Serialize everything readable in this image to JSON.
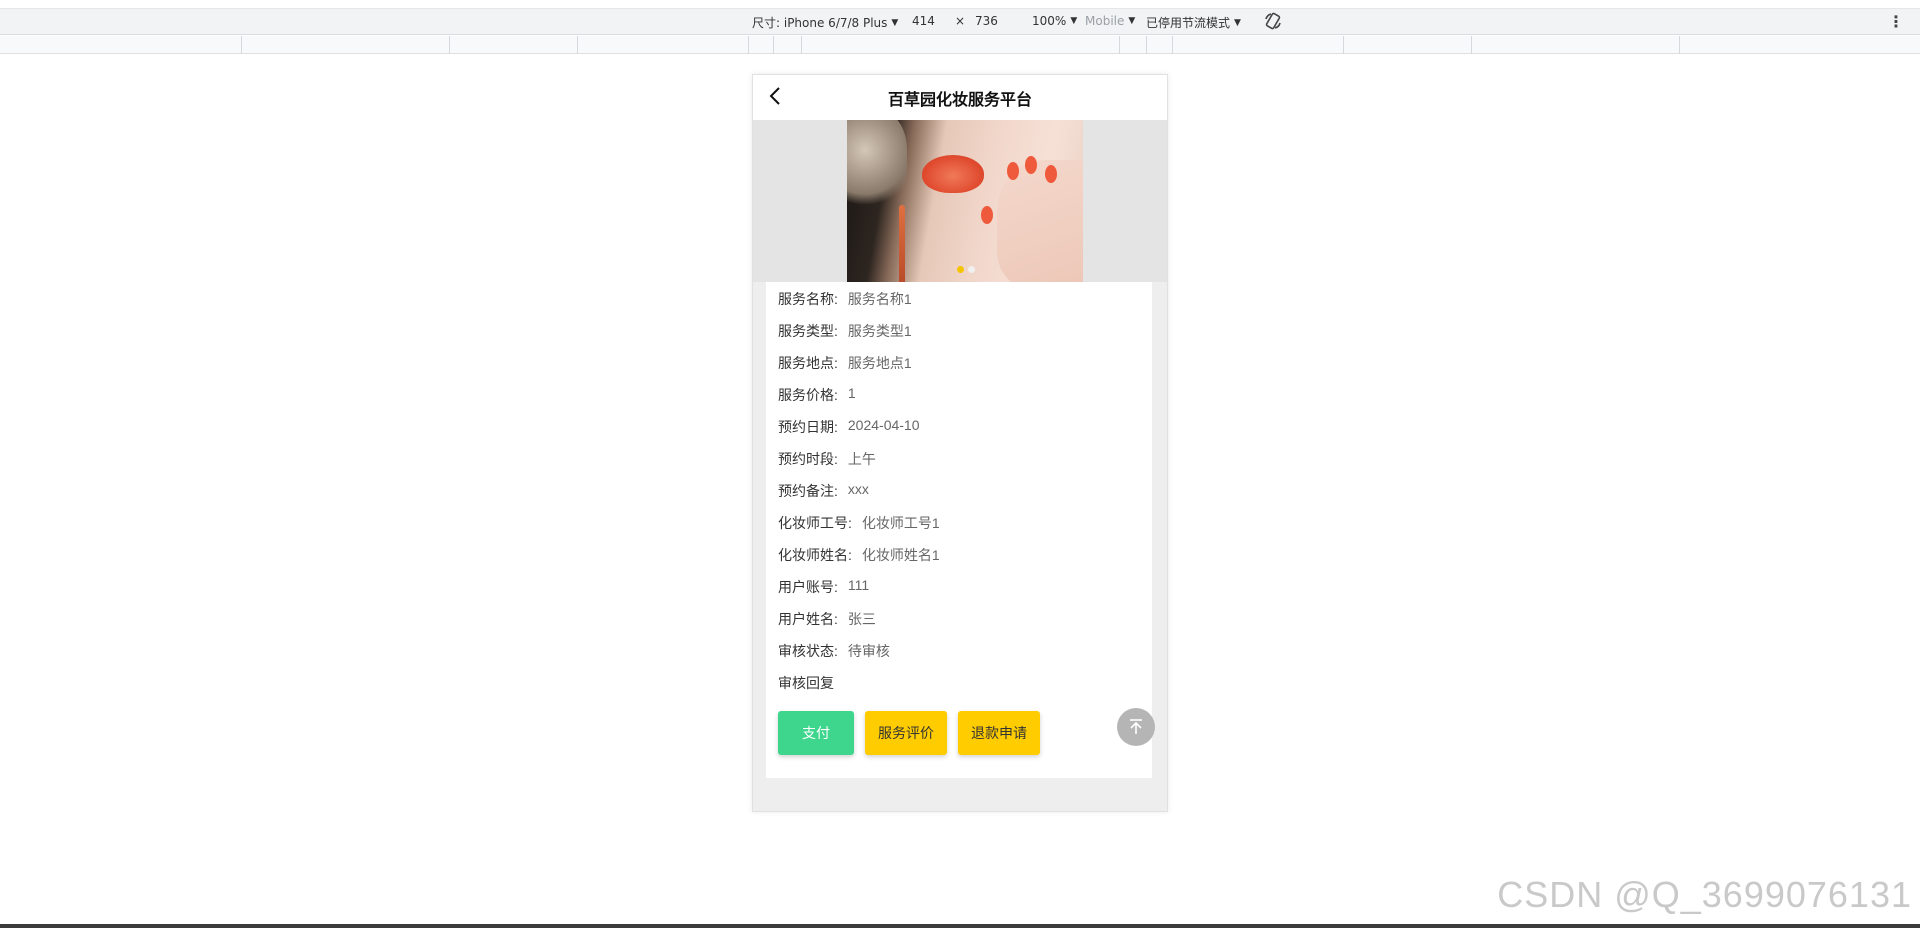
{
  "devtools": {
    "device_label": "尺寸: iPhone 6/7/8 Plus",
    "width": "414",
    "times": "×",
    "height": "736",
    "zoom": "100%",
    "mode": "Mobile",
    "throttle": "已停用节流模式",
    "rotate_icon": "rotate-icon",
    "menu_icon": "more-vertical-icon"
  },
  "header": {
    "back_icon": "chevron-left-icon",
    "title": "百草园化妆服务平台"
  },
  "banner": {
    "dots_total": 2,
    "active_dot": 1
  },
  "details": [
    {
      "label": "服务名称:",
      "value": "服务名称1"
    },
    {
      "label": "服务类型:",
      "value": "服务类型1"
    },
    {
      "label": "服务地点:",
      "value": "服务地点1"
    },
    {
      "label": "服务价格:",
      "value": "1"
    },
    {
      "label": "预约日期:",
      "value": "2024-04-10"
    },
    {
      "label": "预约时段:",
      "value": "上午"
    },
    {
      "label": "预约备注:",
      "value": "xxx"
    },
    {
      "label": "化妆师工号:",
      "value": "化妆师工号1"
    },
    {
      "label": "化妆师姓名:",
      "value": "化妆师姓名1"
    },
    {
      "label": "用户账号:",
      "value": "111"
    },
    {
      "label": "用户姓名:",
      "value": "张三"
    },
    {
      "label": "审核状态:",
      "value": "待审核"
    },
    {
      "label": "审核回复",
      "value": ""
    }
  ],
  "actions": {
    "pay": "支付",
    "review": "服务评价",
    "refund": "退款申请"
  },
  "back_to_top_icon": "arrow-up-to-top-icon",
  "watermark": "CSDN @Q_3699076131",
  "colors": {
    "pay_button": "#3dd68c",
    "secondary_buttons": "#ffcc00",
    "active_dot": "#f5c400"
  }
}
